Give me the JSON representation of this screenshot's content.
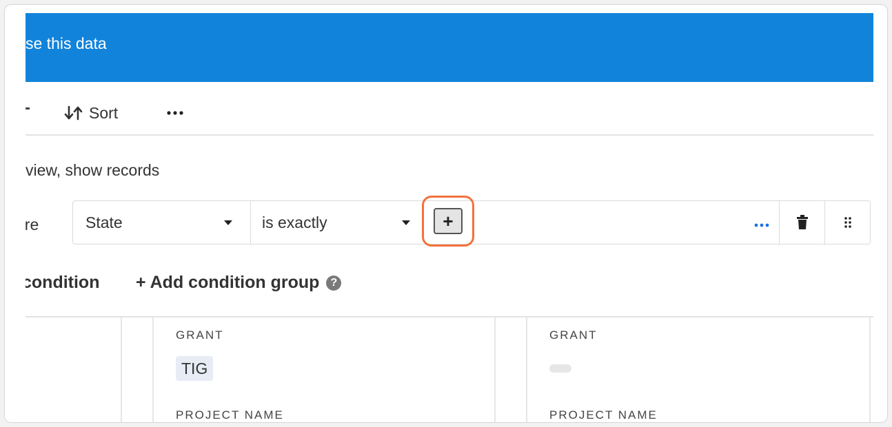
{
  "banner": {
    "text": "se this data"
  },
  "toolbar": {
    "sort_label": "Sort"
  },
  "filter": {
    "description": "view, show records",
    "where_label": "ere",
    "field_value": "State",
    "operator_value": "is exactly",
    "add_value_label": "+"
  },
  "actions": {
    "add_condition": "condition",
    "add_condition_group": "+ Add condition group",
    "help_glyph": "?"
  },
  "records": {
    "card1": {
      "grant_label": "GRANT",
      "grant_value": "TIG",
      "project_label": "PROJECT NAME"
    },
    "card2": {
      "grant_label": "GRANT",
      "project_label": "PROJECT NAME"
    }
  },
  "colors": {
    "banner": "#1283da",
    "highlight": "#f2723a",
    "accent_dots": "#1f6fe5"
  }
}
